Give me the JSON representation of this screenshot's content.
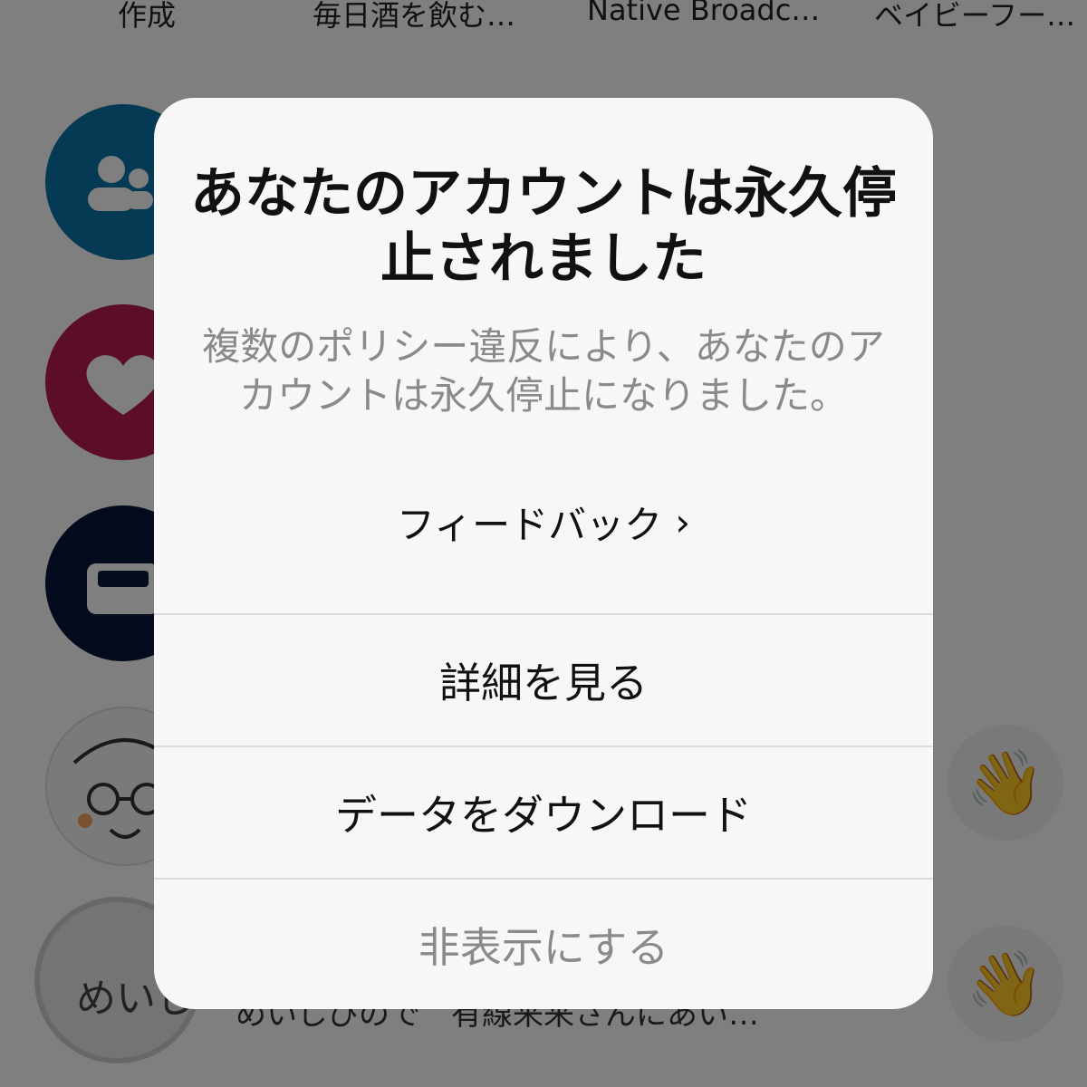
{
  "top_tabs": [
    "作成",
    "毎日酒を飲む…",
    "Native Broadc…",
    "ベイビーフー…"
  ],
  "background": {
    "bottom_text": "めいじびので　有線来来さんにあい…",
    "avatar_sketch_text": "めいじ",
    "wave_icon": "👋",
    "circle_colors": {
      "blue": "#0a74a8",
      "pink": "#b81d4f",
      "navy": "#06163a"
    }
  },
  "dialog": {
    "title": "あなたのアカウントは永久停止されました",
    "body": "複数のポリシー違反により、あなたのアカウントは永久停止になりました。",
    "feedback_label": "フィードバック",
    "feedback_chevron": "›",
    "actions": {
      "see_details": "詳細を見る",
      "download_data": "データをダウンロード",
      "hide": "非表示にする"
    }
  }
}
